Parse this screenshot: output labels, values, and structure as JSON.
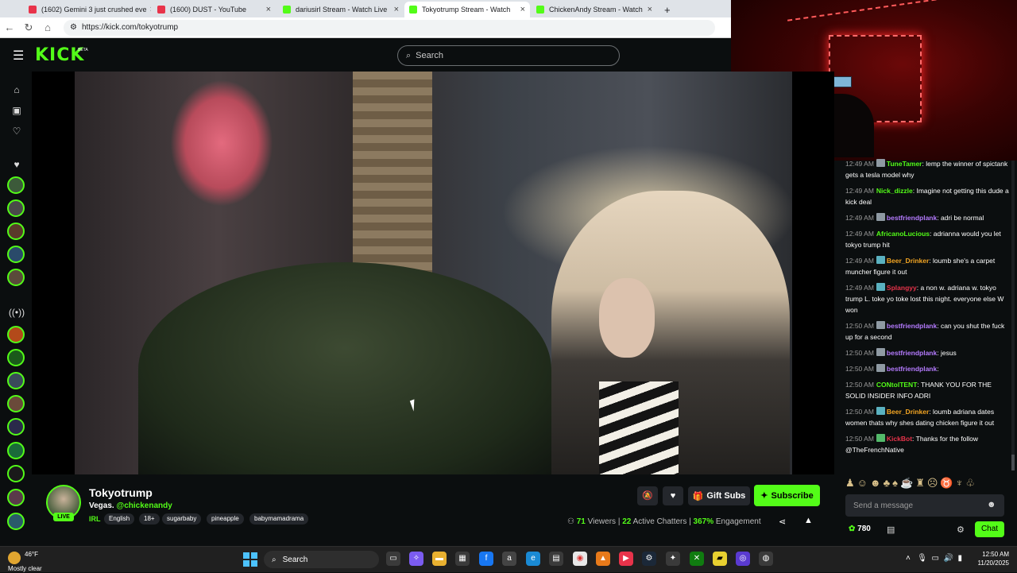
{
  "browser": {
    "tabs": [
      {
        "title": "(1602) Gemini 3 just crushed eve",
        "color": "#e8334a"
      },
      {
        "title": "(1600) DUST - YouTube",
        "color": "#e8334a"
      },
      {
        "title": "dariusirl Stream - Watch Live",
        "color": "#53fc18"
      },
      {
        "title": "Tokyotrump Stream - Watch",
        "color": "#53fc18"
      },
      {
        "title": "ChickenAndy Stream - Watch",
        "color": "#53fc18"
      }
    ],
    "new_tab": "+",
    "url": "https://kick.com/tokyotrump"
  },
  "header": {
    "logo": "KICK",
    "logo_badge": "BETA",
    "search_placeholder": "Search"
  },
  "stream": {
    "channel": "Tokyotrump",
    "live_label": "LIVE",
    "title_prefix": "Vegas.",
    "title_mention": "@chickenandy",
    "category": "IRL",
    "tags": [
      "English",
      "18+",
      "sugarbaby",
      "pineapple",
      "babymamadrama"
    ],
    "gift_label": "Gift Subs",
    "subscribe_label": "Subscribe",
    "viewers": "71",
    "viewers_label": "Viewers",
    "chatters": "22",
    "chatters_label": "Active Chatters",
    "engagement": "367%",
    "engagement_label": "Engagement"
  },
  "chat": {
    "messages": [
      {
        "time": "12:49 AM",
        "user": "TuneTamer",
        "color": "#53fc18",
        "badge": "grey",
        "text": "lemp the winner of spictank gets a tesla model why"
      },
      {
        "time": "12:49 AM",
        "user": "Nick_dizzle",
        "color": "#53fc18",
        "badge": "",
        "text": "Imagine not getting this dude a kick deal"
      },
      {
        "time": "12:49 AM",
        "user": "bestfriendplank",
        "color": "#b57bff",
        "badge": "grey",
        "text": "adri be normal"
      },
      {
        "time": "12:49 AM",
        "user": "AfricanoLucious",
        "color": "#53fc18",
        "badge": "",
        "text": "adrianna would you let tokyo trump hit"
      },
      {
        "time": "12:49 AM",
        "user": "Beer_Drinker",
        "color": "#f5a623",
        "badge": "b",
        "text": "loumb she's a carpet muncher figure it out"
      },
      {
        "time": "12:49 AM",
        "user": "Splangyy",
        "color": "#e8334a",
        "badge": "b",
        "text": "a non w. adriana w. tokyo trump L. toke yo toke lost this night. everyone else W won"
      },
      {
        "time": "12:50 AM",
        "user": "bestfriendplank",
        "color": "#b57bff",
        "badge": "grey",
        "text": "can you shut the fuck up for a second"
      },
      {
        "time": "12:50 AM",
        "user": "bestfriendplank",
        "color": "#b57bff",
        "badge": "grey",
        "text": "jesus"
      },
      {
        "time": "12:50 AM",
        "user": "bestfriendplank",
        "color": "#b57bff",
        "badge": "grey",
        "text": ""
      },
      {
        "time": "12:50 AM",
        "user": "CONtolTENT",
        "color": "#53fc18",
        "badge": "",
        "text": "THANK YOU FOR THE SOLID INSIDER INFO ADRI"
      },
      {
        "time": "12:50 AM",
        "user": "Beer_Drinker",
        "color": "#f5a623",
        "badge": "b",
        "text": "loumb adriana dates women thats why shes dating chicken figure it out"
      },
      {
        "time": "12:50 AM",
        "user": "KickBot",
        "color": "#e8334a",
        "badge": "g",
        "text": "Thanks for the follow @TheFrenchNative"
      }
    ],
    "input_placeholder": "Send a message",
    "points": "780",
    "chat_button": "Chat"
  },
  "taskbar": {
    "temp": "46°F",
    "weather": "Mostly clear",
    "search": "Search",
    "time": "12:50 AM",
    "date": "11/20/2025"
  },
  "icons": {
    "hamburger": "hamburger-icon",
    "search": "search-icon",
    "mute": "mute-icon",
    "heart": "heart-icon",
    "gift": "gift-icon",
    "share": "share-icon",
    "report": "report-icon",
    "emoji": "emoji-icon",
    "settings": "gear-icon"
  }
}
